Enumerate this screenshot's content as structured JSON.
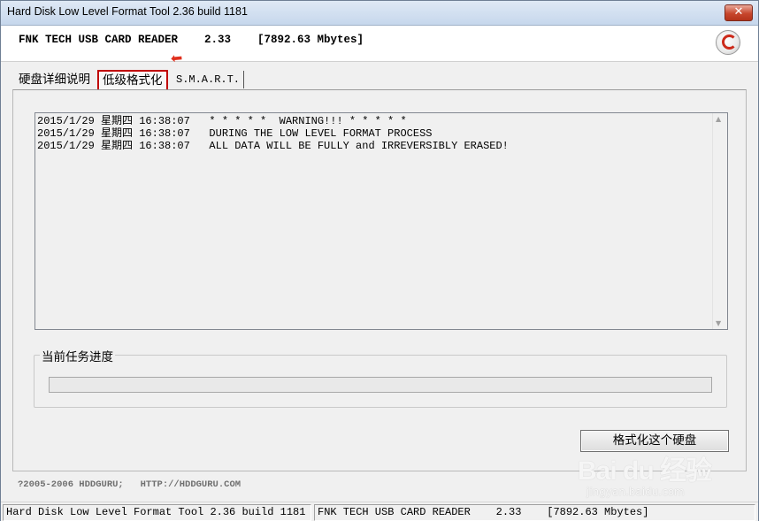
{
  "window": {
    "title": "Hard Disk Low Level Format Tool 2.36 build 1181",
    "close_label": "✕"
  },
  "device_header": {
    "text": "FNK TECH USB CARD READER    2.33    [7892.63 Mbytes]",
    "icon": "app-logo-icon"
  },
  "tabs": [
    {
      "label": "硬盘详细说明"
    },
    {
      "label": "低级格式化",
      "selected": true
    },
    {
      "label": "S.M.A.R.T."
    }
  ],
  "annotation": {
    "icon": "red-arrow-icon",
    "color": "#e0301e"
  },
  "log": {
    "lines": [
      "2015/1/29 星期四 16:38:07   * * * * *  WARNING!!! * * * * *",
      "2015/1/29 星期四 16:38:07   DURING THE LOW LEVEL FORMAT PROCESS",
      "2015/1/29 星期四 16:38:07   ALL DATA WILL BE FULLY and IRREVERSIBLY ERASED!"
    ]
  },
  "progress": {
    "label": "当前任务进度",
    "percent": 0
  },
  "buttons": {
    "format_label": "格式化这个硬盘"
  },
  "footer": {
    "copyright": "?2005-2006 HDDGURU;   HTTP://HDDGURU.COM"
  },
  "watermark": {
    "main": "Bai du 经验",
    "sub": "jingyan.baidu.com"
  },
  "statusbar": {
    "left": "Hard Disk Low Level Format Tool 2.36 build 1181",
    "right": "FNK TECH USB CARD READER    2.33    [7892.63 Mbytes]"
  }
}
